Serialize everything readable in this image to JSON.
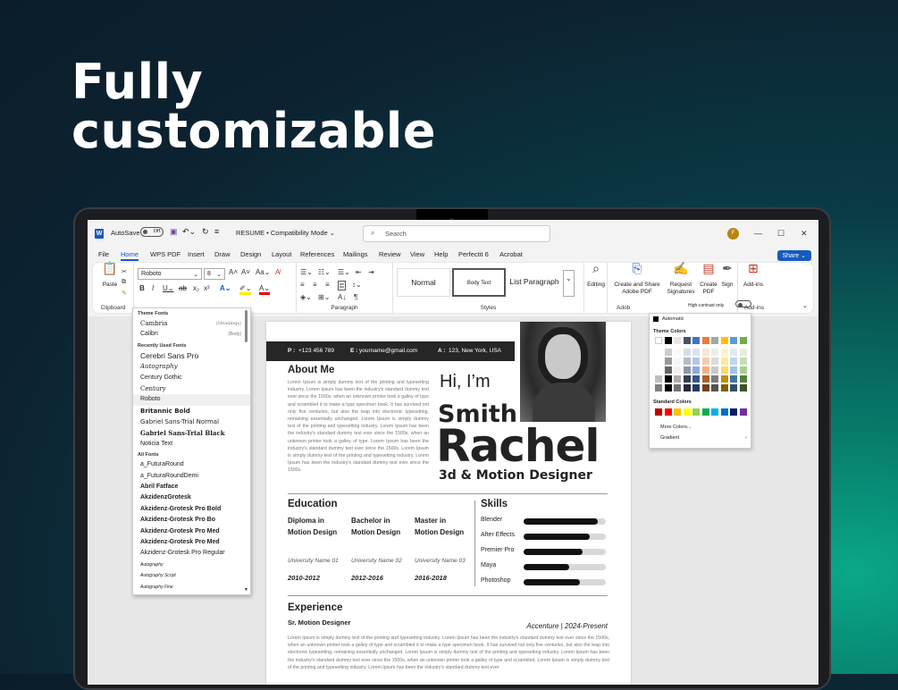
{
  "hero": {
    "line1": "Fully",
    "line2": "customizable"
  },
  "titlebar": {
    "autosave": "AutoSave",
    "toggle": "Off",
    "doc_title": "RESUME  •  Compatibility Mode ⌄",
    "search_placeholder": "Search",
    "avatar": "F"
  },
  "tabs": [
    "File",
    "Home",
    "WPS PDF",
    "Insert",
    "Draw",
    "Design",
    "Layout",
    "References",
    "Mailings",
    "Review",
    "View",
    "Help",
    "Perfectit 6",
    "Acrobat"
  ],
  "share": "Share ⌄",
  "ribbon": {
    "paste": "Paste",
    "clipboard": "Clipboard",
    "font_name": "Roboto",
    "font_size": "8",
    "paragraph": "Paragraph",
    "styles_label": "Styles",
    "styles": [
      "Normal",
      "Body Text",
      "List Paragraph"
    ],
    "editing": "Editing",
    "create_share": "Create and Share Adobe PDF",
    "request_sig": "Request Signatures",
    "create_pdf": "Create PDF",
    "sign": "Sign",
    "addins": "Add-ins",
    "adobe": "Adob",
    "high_contrast": "High-contrast only",
    "addins_group": "Add-ins"
  },
  "font_dropdown": {
    "theme_header": "Theme Fonts",
    "theme": [
      {
        "name": "Cambria",
        "tag": "(Headings)"
      },
      {
        "name": "Calibri",
        "tag": "(Body)"
      }
    ],
    "recent_header": "Recently Used Fonts",
    "recent": [
      "Cerebri Sans Pro",
      "Autography",
      "Century Gothic",
      "Century",
      "Roboto",
      "Britannic Bold",
      "Gabriel Sans-Trial Normal",
      "Gabriel Sans-Trial Black",
      "Noticia Text"
    ],
    "all_header": "All Fonts",
    "all": [
      "a_FuturaRound",
      "a_FuturaRoundDemi",
      "Abril Fatface",
      "AkzidenzGrotesk",
      "Akzidenz-Grotesk Pro Bold",
      "Akzidenz-Grotesk Pro Bo",
      "Akzidenz-Grotesk Pro Med",
      "Akzidenz-Grotesk Pro Med",
      "Akzidenz-Grotesk Pro Regular",
      "Autography",
      "Autography Script",
      "Autography Fine"
    ]
  },
  "resume": {
    "phone_label": "P :",
    "phone": "+123 456 789",
    "email_label": "E :",
    "email": "yourname@gmail.com",
    "addr_label": "A :",
    "addr": "123, New York, USA",
    "about_title": "About Me",
    "about_text": "Lorem Ipsum is simply dummy text of the printing and typesetting industry. Lorem Ipsum has been the industry's standard dummy text ever since the 1500s, when an unknown printer took a galley of type and scrambled it to make a type specimen book. It has survived not only five centuries, but also the leap into electronic typesetting, remaining essentially unchanged. Lorem Ipsum is simply dummy text of the printing and typesetting industry. Lorem Ipsum has been the industry's standard dummy text ever since the 1500s, when an unknown printer took a galley of type. Lorem Ipsum has been the industry's standard dummy text ever since the 1500s. Lorem Ipsum is simply dummy text of the printing and typesetting industry. Lorem Ipsum has been the industry's standard dummy text ever since the 1500s.",
    "hi": "Hi, I’m",
    "first": "Smith",
    "last": "Rachel",
    "role": "3d & Motion Designer",
    "education_title": "Education",
    "education": [
      {
        "degree": "Diploma in Motion Design",
        "uni": "University Name 01",
        "years": "2010-2012"
      },
      {
        "degree": "Bachelor in Motion Design",
        "uni": "University Name 02",
        "years": "2012-2016"
      },
      {
        "degree": "Master in Motion Design",
        "uni": "University Name 03",
        "years": "2016-2018"
      }
    ],
    "skills_title": "Skills",
    "skills": [
      {
        "name": "Blender",
        "level": 0.9
      },
      {
        "name": "After Effects",
        "level": 0.8
      },
      {
        "name": "Premier Pro",
        "level": 0.72
      },
      {
        "name": "Maya",
        "level": 0.55
      },
      {
        "name": "Photoshop",
        "level": 0.68
      }
    ],
    "experience_title": "Experience",
    "exp_role": "Sr. Motion Designer",
    "exp_company": "Accenture | 2024-Present",
    "exp_text": "Lorem Ipsum is simply dummy text of the printing and typesetting industry. Lorem Ipsum has been the industry's standard dummy text ever since the 1500s, when an unknown printer took a galley of type and scrambled it to make a type specimen book. It has survived not only five centuries, but also the leap into electronic typesetting, remaining essentially unchanged. Lorem Ipsum is simply dummy text of the printing and typesetting industry. Lorem Ipsum has been the industry's standard dummy text ever since the 1500s, when an unknown printer took a galley of type and scrambled. Lorem Ipsum is simply dummy text of the printing and typesetting industry. Lorem Ipsum has been the industry's standard dummy text ever"
  },
  "color_panel": {
    "automatic": "Automatic",
    "theme_colors": "Theme Colors",
    "standard_colors": "Standard Colors",
    "more": "More Colors...",
    "gradient": "Gradient",
    "theme_row": [
      "#ffffff",
      "#000000",
      "#e7e6e6",
      "#44546a",
      "#4472c4",
      "#ed7d31",
      "#a5a5a5",
      "#ffc000",
      "#5b9bd5",
      "#70ad47"
    ],
    "standard_row": [
      "#c00000",
      "#ff0000",
      "#ffc000",
      "#ffff00",
      "#92d050",
      "#00b050",
      "#00b0f0",
      "#0070c0",
      "#002060",
      "#7030a0"
    ]
  }
}
